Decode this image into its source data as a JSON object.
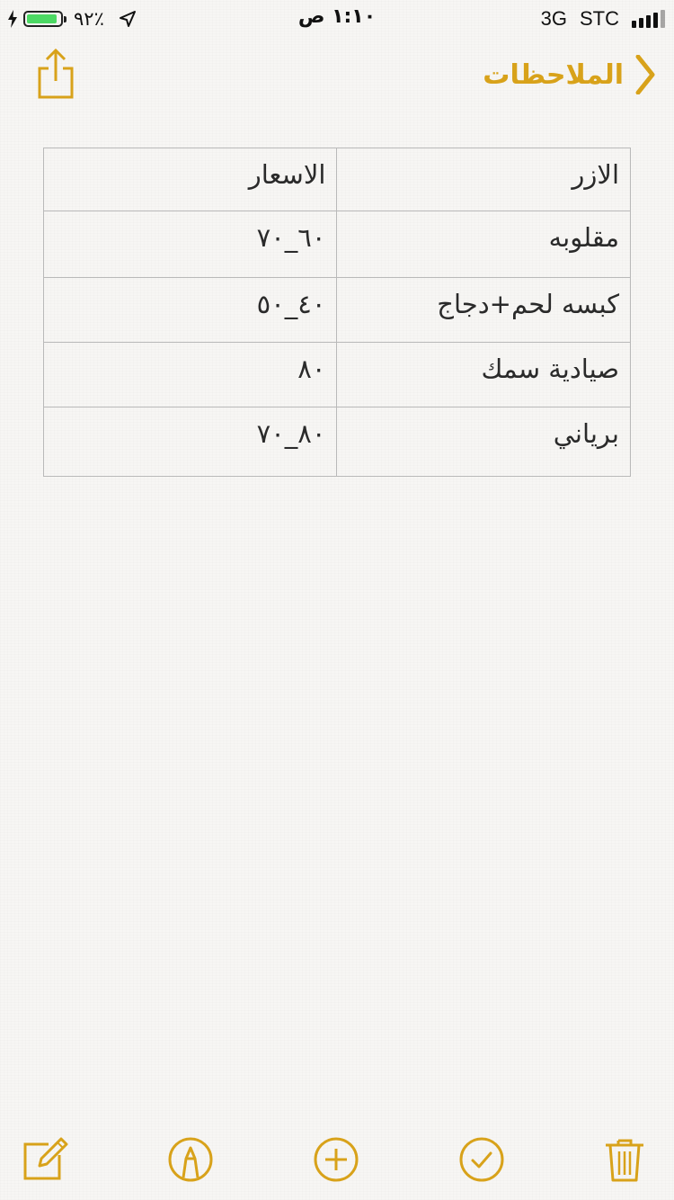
{
  "status_bar": {
    "battery_percent": "٪٩٢",
    "battery_level": 0.92,
    "time": "١:١٠ ص",
    "network": "3G",
    "carrier": "STC",
    "battery_color": "#4cd964"
  },
  "nav": {
    "back_label": "الملاحظات",
    "accent_color": "#d8a21a",
    "back_icon": "chevron-left-icon",
    "share_icon": "share-icon"
  },
  "table": {
    "rows": [
      {
        "dish": "الازر",
        "price": "الاسعار"
      },
      {
        "dish": "مقلوبه",
        "price": "٦٠_٧٠"
      },
      {
        "dish": "كبسه لحم+دجاج",
        "price": "٤٠_٥٠"
      },
      {
        "dish": "صيادية سمك",
        "price": "٨٠"
      },
      {
        "dish": "برياني",
        "price": "٨٠_٧٠"
      }
    ]
  },
  "toolbar": {
    "items": [
      "compose-icon",
      "markup-icon",
      "add-icon",
      "checklist-icon",
      "trash-icon"
    ]
  }
}
